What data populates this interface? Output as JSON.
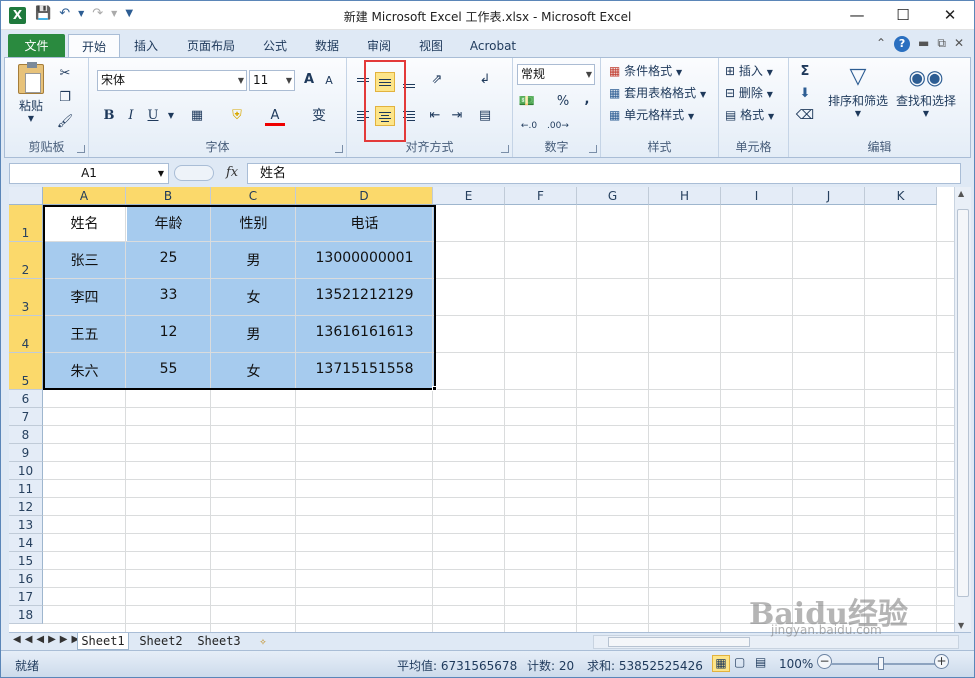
{
  "window": {
    "title": "新建 Microsoft Excel 工作表.xlsx - Microsoft Excel",
    "app_icon": "X"
  },
  "tabs": [
    "文件",
    "开始",
    "插入",
    "页面布局",
    "公式",
    "数据",
    "审阅",
    "视图",
    "Acrobat"
  ],
  "ribbon": {
    "clipboard": {
      "label": "剪贴板",
      "paste": "粘贴"
    },
    "font": {
      "label": "字体",
      "name": "宋体",
      "size": "11",
      "bold": "B",
      "italic": "I",
      "underline": "U",
      "grow": "A",
      "shrink": "A",
      "color_a": "A",
      "wen": "变"
    },
    "alignment": {
      "label": "对齐方式"
    },
    "number": {
      "label": "数字",
      "format": "常规",
      "percent": "%",
      "comma": ","
    },
    "styles": {
      "label": "样式",
      "conditional": "条件格式",
      "table": "套用表格格式",
      "cell_style": "单元格样式"
    },
    "cells": {
      "label": "单元格",
      "insert": "插入",
      "delete": "删除",
      "format": "格式"
    },
    "editing": {
      "label": "编辑",
      "sort": "排序和筛选",
      "find": "查找和选择"
    }
  },
  "formula_bar": {
    "name_box": "A1",
    "fx": "fx",
    "value": "姓名"
  },
  "columns": [
    "A",
    "B",
    "C",
    "D",
    "E",
    "F",
    "G",
    "H",
    "I",
    "J",
    "K"
  ],
  "rows": [
    "1",
    "2",
    "3",
    "4",
    "5",
    "6",
    "7",
    "8",
    "9",
    "10",
    "11",
    "12",
    "13",
    "14",
    "15",
    "16",
    "17",
    "18"
  ],
  "table": [
    [
      "姓名",
      "年龄",
      "性别",
      "电话"
    ],
    [
      "张三",
      "25",
      "男",
      "13000000001"
    ],
    [
      "李四",
      "33",
      "女",
      "13521212129"
    ],
    [
      "王五",
      "12",
      "男",
      "13616161613"
    ],
    [
      "朱六",
      "55",
      "女",
      "13715151558"
    ]
  ],
  "sheets": [
    "Sheet1",
    "Sheet2",
    "Sheet3"
  ],
  "status": {
    "ready": "就绪",
    "average": "平均值: 6731565678",
    "count": "计数: 20",
    "sum": "求和: 53852525426",
    "zoom": "100%"
  },
  "watermark": {
    "brand": "Baidu经验",
    "url": "jingyan.baidu.com"
  },
  "colors": {
    "file_tab": "#2a8a3f",
    "selection": "#a6cbee",
    "highlight": "#fde589",
    "red_box": "#e33a3a"
  }
}
